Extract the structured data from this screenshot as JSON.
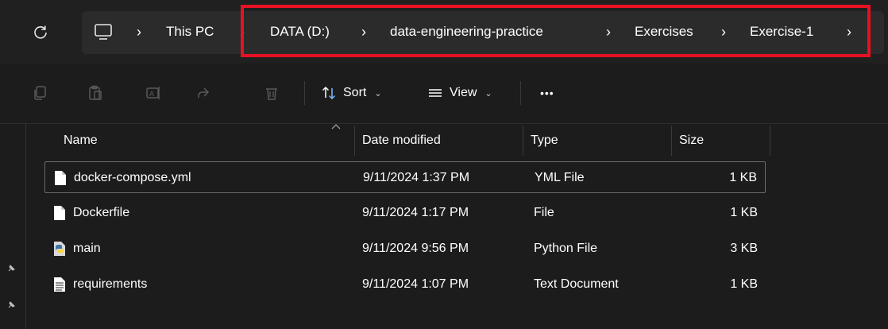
{
  "breadcrumb": {
    "items": [
      "This PC",
      "DATA (D:)",
      "data-engineering-practice",
      "Exercises",
      "Exercise-1"
    ],
    "separator": "›"
  },
  "toolbar": {
    "sort_label": "Sort",
    "view_label": "View",
    "more_label": "•••"
  },
  "columns": {
    "name": "Name",
    "date": "Date modified",
    "type": "Type",
    "size": "Size"
  },
  "files": [
    {
      "name": "docker-compose.yml",
      "date": "9/11/2024 1:37 PM",
      "type": "YML File",
      "size": "1 KB",
      "icon": "file-icon",
      "selected": true
    },
    {
      "name": "Dockerfile",
      "date": "9/11/2024 1:17 PM",
      "type": "File",
      "size": "1 KB",
      "icon": "file-icon",
      "selected": false
    },
    {
      "name": "main",
      "date": "9/11/2024 9:56 PM",
      "type": "Python File",
      "size": "3 KB",
      "icon": "python-file-icon",
      "selected": false
    },
    {
      "name": "requirements",
      "date": "9/11/2024 1:07 PM",
      "type": "Text Document",
      "size": "1 KB",
      "icon": "text-file-icon",
      "selected": false
    }
  ],
  "colors": {
    "background": "#1c1c1c",
    "address_box": "#2b2b2b",
    "highlight": "#e81123",
    "text": "#ffffff"
  }
}
